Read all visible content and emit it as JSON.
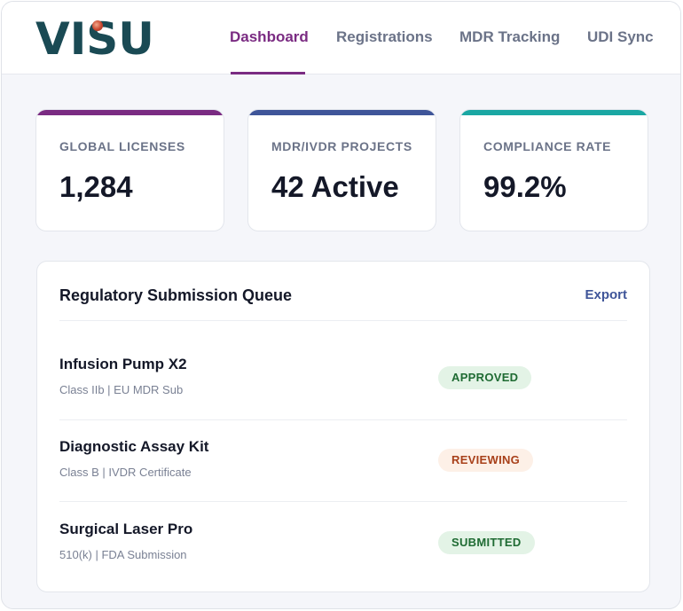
{
  "brand": {
    "logo_text": "VISU"
  },
  "nav": {
    "items": [
      {
        "label": "Dashboard",
        "active": true
      },
      {
        "label": "Registrations",
        "active": false
      },
      {
        "label": "MDR Tracking",
        "active": false
      },
      {
        "label": "UDI Sync",
        "active": false
      }
    ]
  },
  "stats": [
    {
      "label": "GLOBAL LICENSES",
      "value": "1,284",
      "accent": "#7a2b82"
    },
    {
      "label": "MDR/IVDR PROJECTS",
      "value": "42 Active",
      "accent": "#3f5599"
    },
    {
      "label": "COMPLIANCE RATE",
      "value": "99.2%",
      "accent": "#1aa7a3"
    }
  ],
  "queue": {
    "title": "Regulatory Submission Queue",
    "export_label": "Export",
    "rows": [
      {
        "name": "Infusion Pump X2",
        "subtitle": "Class IIb | EU MDR Sub",
        "status": "APPROVED"
      },
      {
        "name": "Diagnostic Assay Kit",
        "subtitle": "Class B | IVDR Certificate",
        "status": "REVIEWING"
      },
      {
        "name": "Surgical Laser Pro",
        "subtitle": "510(k) | FDA Submission",
        "status": "SUBMITTED"
      }
    ]
  },
  "colors": {
    "brand": "#1a4a54",
    "nav_active": "#7a2b82",
    "approved_bg": "#e3f3e6",
    "reviewing_bg": "#fdf0e7"
  }
}
